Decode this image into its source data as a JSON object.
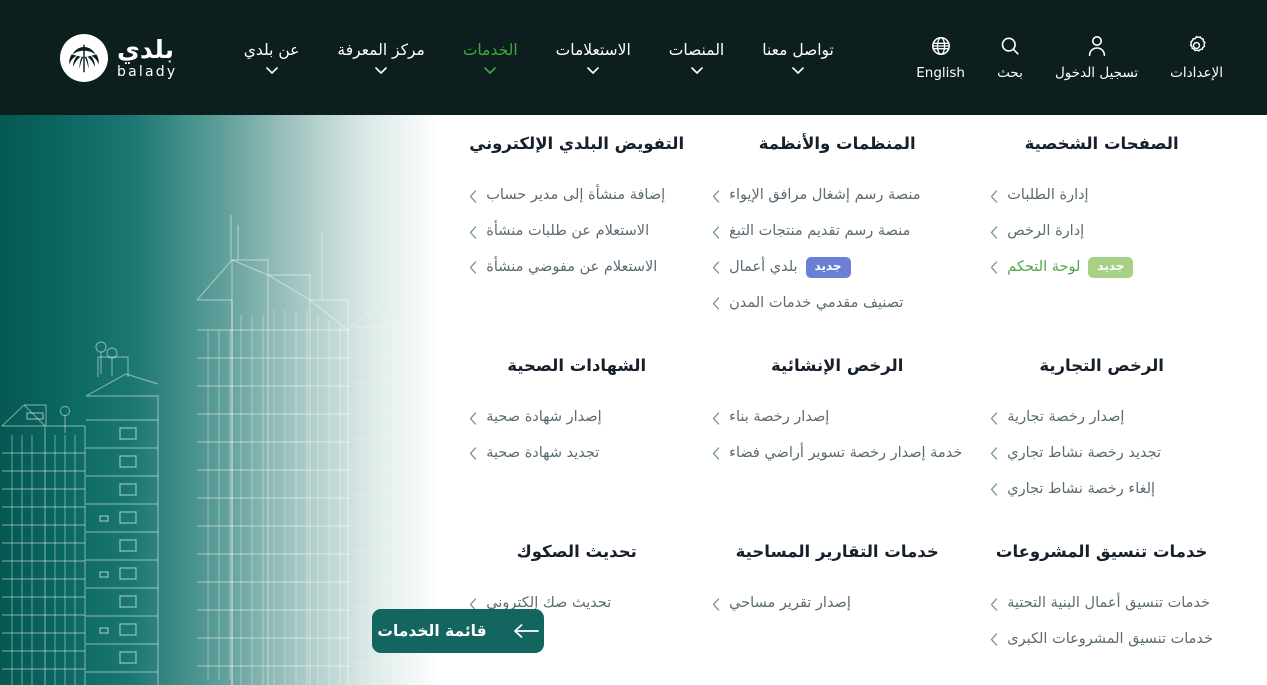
{
  "brand": {
    "name_ar": "بلدي",
    "name_en": "balady",
    "logo_icon": "palm-tree-icon",
    "header_bg": "#0c1e1d",
    "accent_green": "#3ea93c",
    "cta_teal": "#136560"
  },
  "nav": {
    "items": [
      {
        "label": "عن بلدي",
        "active": false,
        "has_caret": true
      },
      {
        "label": "مركز المعرفة",
        "active": false,
        "has_caret": true
      },
      {
        "label": "الخدمات",
        "active": true,
        "has_caret": true
      },
      {
        "label": "الاستعلامات",
        "active": false,
        "has_caret": true
      },
      {
        "label": "المنصات",
        "active": false,
        "has_caret": true
      },
      {
        "label": "تواصل معنا",
        "active": false,
        "has_caret": true
      }
    ]
  },
  "utils": {
    "items": [
      {
        "label": "English",
        "icon": "globe-icon"
      },
      {
        "label": "بحث",
        "icon": "search-icon"
      },
      {
        "label": "تسجيل الدخول",
        "icon": "user-icon"
      },
      {
        "label": "الإعدادات",
        "icon": "gear-icon"
      }
    ]
  },
  "mega_menu": {
    "sections": [
      {
        "title": "الصفحات الشخصية",
        "links": [
          {
            "label": "إدارة الطلبات",
            "badge": null,
            "highlight": false
          },
          {
            "label": "إدارة الرخص",
            "badge": null,
            "highlight": false
          },
          {
            "label": "لوحة التحكم",
            "badge": "جديد",
            "badge_color": "#a6d187",
            "highlight": true
          }
        ]
      },
      {
        "title": "المنظمات والأنظمة",
        "links": [
          {
            "label": "منصة رسم إشغال مرافق الإيواء",
            "badge": null,
            "highlight": false
          },
          {
            "label": "منصة رسم تقديم منتجات التبغ",
            "badge": null,
            "highlight": false
          },
          {
            "label": "بلدي أعمال",
            "badge": "جديد",
            "badge_color": "#6b7fd7",
            "highlight": false
          },
          {
            "label": "تصنيف مقدمي خدمات المدن",
            "badge": null,
            "highlight": false
          }
        ]
      },
      {
        "title": "التفويض البلدي الإلكتروني",
        "links": [
          {
            "label": "إضافة منشأة إلى مدير حساب",
            "badge": null,
            "highlight": false
          },
          {
            "label": "الاستعلام عن طلبات منشأة",
            "badge": null,
            "highlight": false
          },
          {
            "label": "الاستعلام عن مفوضي منشأة",
            "badge": null,
            "highlight": false
          }
        ]
      },
      {
        "title": "الرخص التجارية",
        "links": [
          {
            "label": "إصدار رخصة تجارية",
            "badge": null,
            "highlight": false
          },
          {
            "label": "تجديد رخصة نشاط تجاري",
            "badge": null,
            "highlight": false
          },
          {
            "label": "إلغاء رخصة نشاط تجاري",
            "badge": null,
            "highlight": false
          }
        ]
      },
      {
        "title": "الرخص الإنشائية",
        "links": [
          {
            "label": "إصدار رخصة بناء",
            "badge": null,
            "highlight": false
          },
          {
            "label": "خدمة إصدار رخصة تسوير أراضي فضاء",
            "badge": null,
            "highlight": false
          }
        ]
      },
      {
        "title": "الشهادات الصحية",
        "links": [
          {
            "label": "إصدار شهادة صحية",
            "badge": null,
            "highlight": false
          },
          {
            "label": "تجديد شهادة صحية",
            "badge": null,
            "highlight": false
          }
        ]
      },
      {
        "title": "خدمات تنسيق المشروعات",
        "links": [
          {
            "label": "خدمات تنسيق أعمال البنية التحتية",
            "badge": null,
            "highlight": false
          },
          {
            "label": "خدمات تنسيق المشروعات الكبرى",
            "badge": null,
            "highlight": false
          }
        ]
      },
      {
        "title": "خدمات التقارير المساحية",
        "links": [
          {
            "label": "إصدار تقرير مساحي",
            "badge": null,
            "highlight": false
          }
        ]
      },
      {
        "title": "تحديث الصكوك",
        "links": [
          {
            "label": "تحديث صك إلكتروني",
            "badge": null,
            "highlight": false
          }
        ]
      }
    ]
  },
  "cta": {
    "label": "قائمة الخدمات",
    "icon": "arrow-left-icon"
  }
}
